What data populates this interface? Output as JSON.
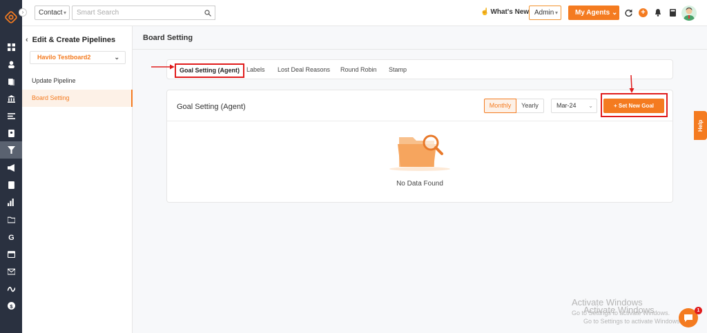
{
  "topbar": {
    "contact_select": "Contact",
    "search_placeholder": "Smart Search",
    "whats_new": "What's New",
    "admin_select": "Admin",
    "my_agents": "My Agents"
  },
  "sidebar": {
    "title": "Edit & Create Pipelines",
    "board_select": "Havilo Testboard2",
    "items": [
      {
        "label": "Update Pipeline"
      },
      {
        "label": "Board Setting"
      }
    ]
  },
  "main": {
    "title": "Board Setting",
    "tabs": [
      {
        "label": "Goal Setting (Agent)"
      },
      {
        "label": "Labels"
      },
      {
        "label": "Lost Deal Reasons"
      },
      {
        "label": "Round Robin"
      },
      {
        "label": "Stamp"
      }
    ],
    "goal_card": {
      "title": "Goal Setting (Agent)",
      "period_monthly": "Monthly",
      "period_yearly": "Yearly",
      "month_select": "Mar-24",
      "new_goal_button": "+ Set New Goal",
      "empty_text": "No Data Found"
    }
  },
  "help_tab": "Help",
  "watermark": {
    "line1": "Activate Windows",
    "line2": "Go to Settings to activate Windows.",
    "line3": "Activate Windows",
    "line4": "Go to Settings to activate Windows."
  },
  "chat_badge": "1",
  "colors": {
    "accent": "#f47b20",
    "annotation": "#e01b1b",
    "rail": "#2a3140"
  }
}
